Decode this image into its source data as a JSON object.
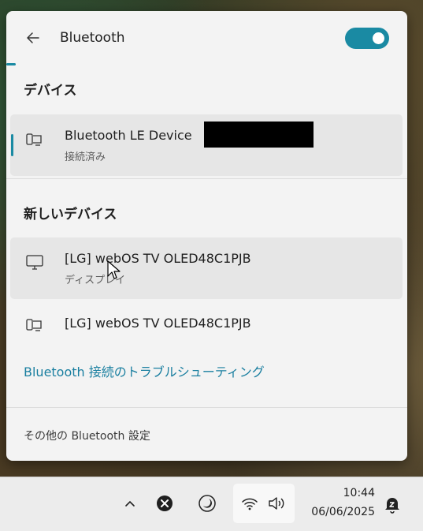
{
  "header": {
    "title": "Bluetooth",
    "toggle_state": "on"
  },
  "sections": {
    "devices": "デバイス",
    "new_devices": "新しいデバイス"
  },
  "devices": [
    {
      "name": "Bluetooth LE Device",
      "status": "接続済み",
      "icon": "phone-laptop-icon"
    }
  ],
  "new_devices": [
    {
      "name": "[LG] webOS TV OLED48C1PJB",
      "status": "ディスプレイ",
      "icon": "monitor-icon"
    },
    {
      "name": "[LG] webOS TV OLED48C1PJB",
      "status": "",
      "icon": "phone-laptop-icon"
    }
  ],
  "troubleshoot_link": "Bluetooth 接続のトラブルシューティング",
  "footer_link": "その他の Bluetooth 設定",
  "taskbar": {
    "time": "10:44",
    "date": "06/06/2025"
  },
  "colors": {
    "accent": "#1a8aa3",
    "link": "#1a7fa0"
  }
}
